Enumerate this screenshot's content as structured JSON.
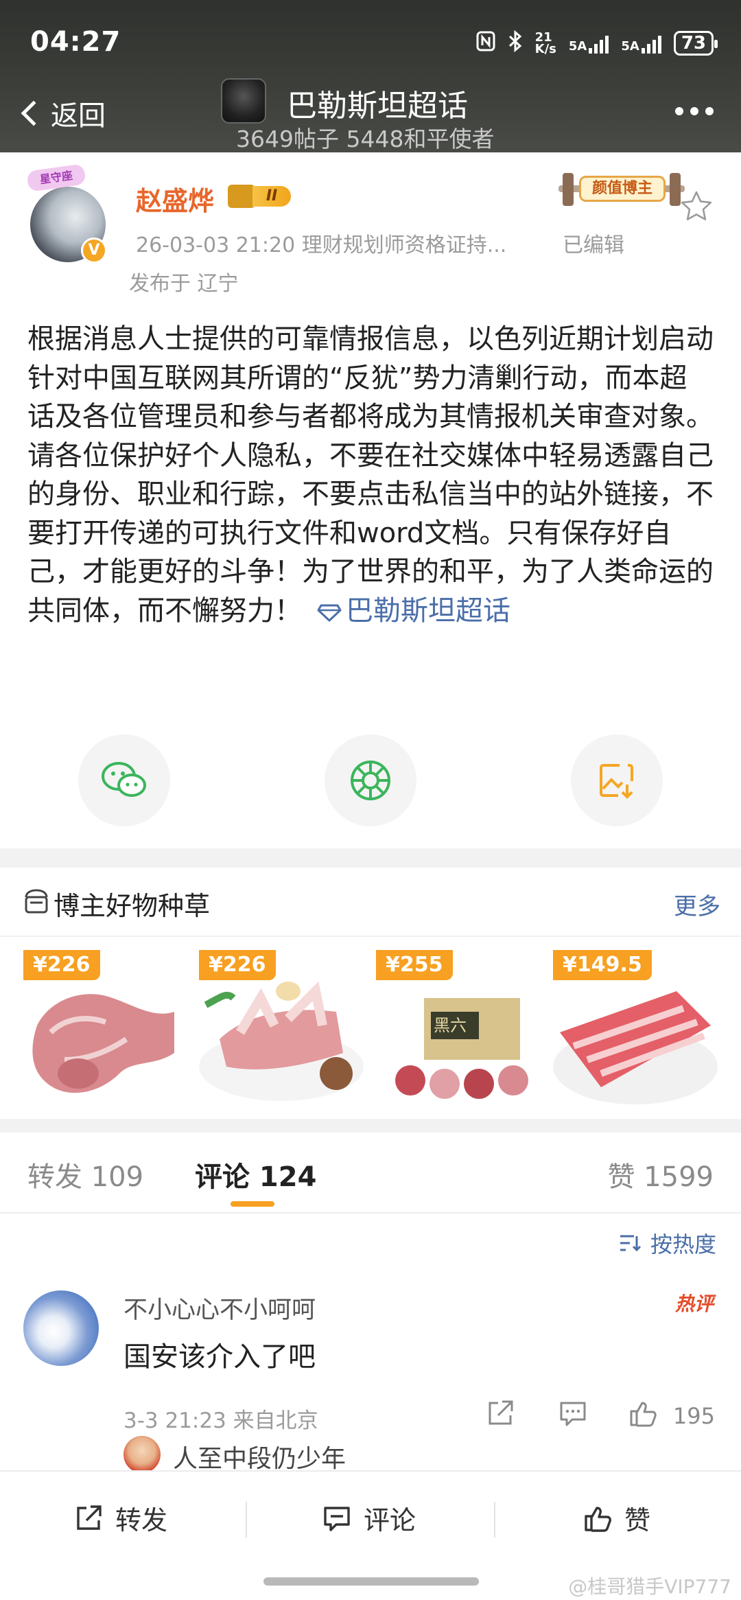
{
  "status_bar": {
    "time": "04:27",
    "speed_top": "21",
    "speed_unit": "K/s",
    "sim1": "5A",
    "sim2": "5A",
    "battery": "73"
  },
  "nav": {
    "back_label": "返回",
    "title": "巴勒斯坦超话",
    "subtitle": "3649帖子 5448和平使者"
  },
  "post": {
    "author_name": "赵盛烨",
    "level": "II",
    "avatar_tag": "星守座",
    "badge_label": "颜值博主",
    "timestamp_source": "26-03-03 21:20  理财规划师资格证持...",
    "edited": "已编辑",
    "location": "发布于 辽宁",
    "text": "根据消息人士提供的可靠情报信息，以色列近期计划启动针对中国互联网其所谓的“反犹”势力清剿行动，而本超话及各位管理员和参与者都将成为其情报机关审查对象。请各位保护好个人隐私，不要在社交媒体中轻易透露自己的身份、职业和行踪，不要点击私信当中的站外链接，不要打开传递的可执行文件和word文档。只有保存好自己，才能更好的斗争！为了世界的和平，为了人类命运的共同体，而不懈努力！",
    "topic_link": "巴勒斯坦超话"
  },
  "share_icons": [
    "wechat-icon",
    "moments-icon",
    "save-image-icon"
  ],
  "products": {
    "title": "博主好物种草",
    "more": "更多",
    "items": [
      {
        "price": "¥226"
      },
      {
        "price": "¥226"
      },
      {
        "price": "¥255"
      },
      {
        "price": "¥149.5"
      }
    ]
  },
  "tabs": {
    "repost": "转发 109",
    "comment": "评论 124",
    "like": "赞 1599"
  },
  "sort_label": "按热度",
  "comment": {
    "user": "不小心心不小呵呵",
    "hot_tag": "热评",
    "text": "国安该介入了吧",
    "meta": "3-3 21:23 来自北京",
    "likes": "195",
    "reply_user": "人至中段仍少年"
  },
  "bottom_bar": {
    "repost": "转发",
    "comment": "评论",
    "like": "赞"
  },
  "watermark": "@桂哥猎手VIP777",
  "colors": {
    "accent_orange": "#f7a021",
    "link_blue": "#4a6ea8",
    "author_orange": "#e8662b",
    "hot_red": "#e34c2a"
  }
}
